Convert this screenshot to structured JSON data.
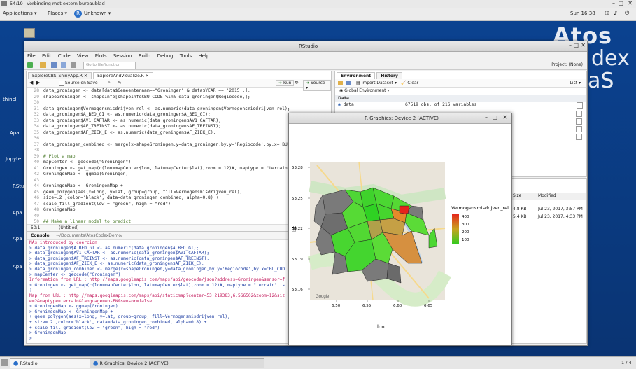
{
  "top_bar": {
    "time": "54:19",
    "title": "Verbinding met extern bureaublad"
  },
  "gnome": {
    "applications": "Applications",
    "places": "Places",
    "unknown": "Unknown",
    "clock": "Sun 16:38"
  },
  "desktop": {
    "brand_line1": "Atos",
    "brand_line2": "dex",
    "brand_line3": "aS",
    "icons": [
      "thincl",
      "Apa",
      "Jupyte",
      "RStu",
      "Apa",
      "Apa",
      "Apa"
    ]
  },
  "rstudio": {
    "title": "RStudio",
    "menu": [
      "File",
      "Edit",
      "Code",
      "View",
      "Plots",
      "Session",
      "Build",
      "Debug",
      "Tools",
      "Help"
    ],
    "goto_placeholder": "Go to file/function",
    "project": "Project: (None)",
    "editor_tabs": [
      "ExploreCBS_ShinyApp.R",
      "ExploreAndVisualize.R"
    ],
    "editor_toolbar": {
      "source_on_save": "Source on Save",
      "run": "Run",
      "source": "Source"
    },
    "code_lines": [
      {
        "n": "28",
        "t": "data_groningen <- data[data$Gemeentenaam==\"Groningen\" & data$YEAR == '2015',];"
      },
      {
        "n": "29",
        "t": "shapeGroningen <- shapeInfo[shapeInfo$BU_CODE %in% data_groningen$Regiocode,];"
      },
      {
        "n": "30",
        "t": ""
      },
      {
        "n": "31",
        "t": "data_groningen$Vermogensmisdrijven_rel <- as.numeric(data_groningen$Vermogensmisdrijven_rel);"
      },
      {
        "n": "32",
        "t": "data_groningen$A_BED_GI <- as.numeric(data_groningen$A_BED_GI);"
      },
      {
        "n": "33",
        "t": "data_groningen$AV1_CAFTAR <- as.numeric(data_groningen$AV1_CAFTAR);"
      },
      {
        "n": "34",
        "t": "data_groningen$AF_TREINST <- as.numeric(data_groningen$AF_TREINST);"
      },
      {
        "n": "35",
        "t": "data_groningen$AF_ZIEK_E <- as.numeric(data_groningen$AF_ZIEK_E);"
      },
      {
        "n": "36",
        "t": ""
      },
      {
        "n": "37",
        "t": "data_groningen_combined <- merge(x=shapeGroningen,y=data_groningen,by.y='Regiocode',by.x='BU"
      },
      {
        "n": "38",
        "t": ""
      },
      {
        "n": "39",
        "t": "# Plot a map"
      },
      {
        "n": "40",
        "t": "mapCenter <- geocode(\"Groningen\")"
      },
      {
        "n": "41",
        "t": "Groningen <- get_map(c(lon=mapCenter$lon, lat=mapCenter$lat),zoom = 12)#, maptype = \"terrain"
      },
      {
        "n": "42",
        "t": "GroningenMap <- ggmap(Groningen)"
      },
      {
        "n": "43",
        "t": ""
      },
      {
        "n": "44",
        "t": "GroningenMap <- GroningenMap +"
      },
      {
        "n": "45",
        "t": "geom_polygon(aes(x=long, y=lat, group=group, fill=Vermogensmisdrijven_rel),"
      },
      {
        "n": "46",
        "t": "size=.2 ,color='black', data=data_groningen_combined, alpha=0.8) +"
      },
      {
        "n": "47",
        "t": "scale_fill_gradient(low = \"green\", high = \"red\")"
      },
      {
        "n": "48",
        "t": "GroningenMap"
      },
      {
        "n": "49",
        "t": ""
      },
      {
        "n": "50",
        "t": "## Make a linear model to predict"
      }
    ],
    "editor_status": {
      "pos": "50:1",
      "scope": "(Untitled)"
    },
    "console": {
      "tab": "Console",
      "path": "~/Documents/AtosCodexDemo/",
      "lines": [
        {
          "c": "red",
          "t": "NAs introduced by coercion"
        },
        {
          "c": "blue",
          "t": "> data_groningen$A_BED_GI <- as.numeric(data_groningen$A_BED_GI);"
        },
        {
          "c": "blue",
          "t": "> data_groningen$AV1_CAFTAR <- as.numeric(data_groningen$AV1_CAFTAR);"
        },
        {
          "c": "blue",
          "t": "> data_groningen$AF_TREINST <- as.numeric(data_groningen$AF_TREINST);"
        },
        {
          "c": "blue",
          "t": "> data_groningen$AF_ZIEK_E <- as.numeric(data_groningen$AF_ZIEK_E);"
        },
        {
          "c": "blue",
          "t": "> data_groningen_combined <- merge(x=shapeGroningen,y=data_groningen,by.y='Regiocode',by.x='BU_COD"
        },
        {
          "c": "blue",
          "t": "> mapCenter <- geocode(\"Groningen\")"
        },
        {
          "c": "red",
          "t": "Information from URL : http://maps.googleapis.com/maps/api/geocode/json?address=Groningen&sensor=f"
        },
        {
          "c": "blue",
          "t": "> Groningen <- get_map(c(lon=mapCenter$lon, lat=mapCenter$lat),zoom = 12)#, maptype = \"terrain\", s"
        },
        {
          "c": "blue",
          "t": ")"
        },
        {
          "c": "red",
          "t": "Map from URL : http://maps.googleapis.com/maps/api/staticmap?center=53.219383,6.566502&zoom=12&siz"
        },
        {
          "c": "red",
          "t": "e=2&maptype=terrain&language=en-EN&sensor=false"
        },
        {
          "c": "blue",
          "t": "> GroningenMap <- ggmap(Groningen)"
        },
        {
          "c": "blue",
          "t": "> GroningenMap <- GroningenMap +"
        },
        {
          "c": "blue",
          "t": "+ geom_polygon(aes(x=long, y=lat, group=group, fill=Vermogensmisdrijven_rel),"
        },
        {
          "c": "blue",
          "t": "+ size=.2 ,color='black', data=data_groningen_combined, alpha=0.8) +"
        },
        {
          "c": "blue",
          "t": "+ scale_fill_gradient(low = \"green\", high = \"red\")"
        },
        {
          "c": "blue",
          "t": "> GroningenMap"
        },
        {
          "c": "blue",
          "t": ">"
        }
      ]
    },
    "env": {
      "tabs": [
        "Environment",
        "History"
      ],
      "import": "Import Dataset",
      "clear": "Clear",
      "list": "List",
      "global": "Global Environment",
      "section": "Data",
      "row_name": "data",
      "row_value": "67519 obs. of 216 variables"
    },
    "files": {
      "col_size": "Size",
      "col_modified": "Modified",
      "rows": [
        {
          "size": "4.8 KB",
          "modified": "Jul 23, 2017, 3:57 PM"
        },
        {
          "size": "5.4 KB",
          "modified": "Jul 23, 2017, 4:33 PM"
        }
      ]
    }
  },
  "rgraphics": {
    "title": "R Graphics: Device 2 (ACTIVE)",
    "map": {
      "xlabel": "lon",
      "ylabel": "lat",
      "xticks": [
        "6.50",
        "6.55",
        "6.60",
        "6.65"
      ],
      "yticks": [
        "53.28",
        "53.25",
        "53.22",
        "53.19",
        "53.16"
      ],
      "legend_title": "Vermogensmisdrijven_rel",
      "legend_values": [
        "400",
        "300",
        "200",
        "100"
      ],
      "google": "Google",
      "color_low": "#2ecc1f",
      "color_high": "#e6221c"
    }
  },
  "taskbar": {
    "rstudio": "RStudio",
    "rgraphics": "R Graphics: Device 2 (ACTIVE)",
    "pager": "1 / 4"
  }
}
